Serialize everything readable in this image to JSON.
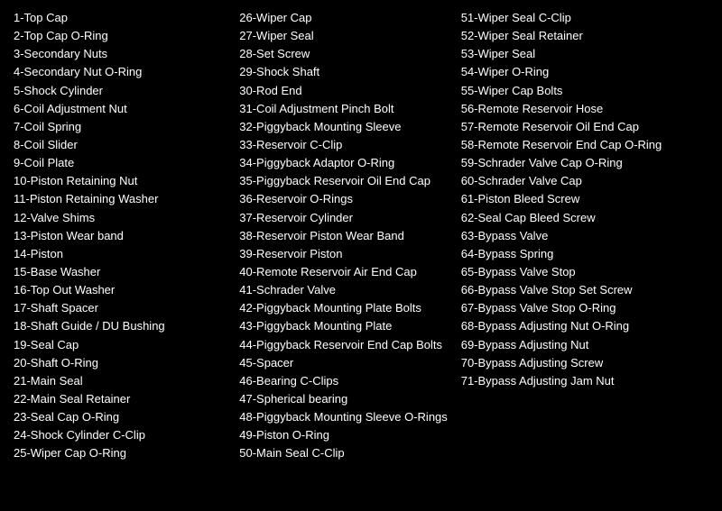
{
  "columns": [
    {
      "id": "col1",
      "items": [
        "1-Top Cap",
        "2-Top Cap O-Ring",
        "3-Secondary Nuts",
        "4-Secondary Nut O-Ring",
        "5-Shock Cylinder",
        "6-Coil Adjustment Nut",
        "7-Coil Spring",
        "8-Coil Slider",
        "9-Coil Plate",
        "10-Piston Retaining Nut",
        "11-Piston Retaining Washer",
        "12-Valve Shims",
        "13-Piston Wear band",
        "14-Piston",
        "15-Base Washer",
        "16-Top Out Washer",
        "17-Shaft Spacer",
        "18-Shaft Guide / DU Bushing",
        "19-Seal Cap",
        "20-Shaft O-Ring",
        "21-Main Seal",
        "22-Main Seal Retainer",
        "23-Seal Cap O-Ring",
        "24-Shock Cylinder C-Clip",
        "25-Wiper Cap O-Ring"
      ]
    },
    {
      "id": "col2",
      "items": [
        "26-Wiper Cap",
        "27-Wiper Seal",
        "28-Set Screw",
        "29-Shock Shaft",
        "30-Rod End",
        "31-Coil Adjustment Pinch Bolt",
        "32-Piggyback Mounting Sleeve",
        "33-Reservoir C-Clip",
        "34-Piggyback Adaptor O-Ring",
        "35-Piggyback Reservoir Oil End Cap",
        "36-Reservoir O-Rings",
        "37-Reservoir Cylinder",
        "38-Reservoir Piston Wear Band",
        "39-Reservoir Piston",
        "40-Remote Reservoir Air End Cap",
        "41-Schrader Valve",
        "42-Piggyback Mounting Plate Bolts",
        "43-Piggyback Mounting Plate",
        "44-Piggyback Reservoir End Cap Bolts",
        "45-Spacer",
        "46-Bearing C-Clips",
        "47-Spherical bearing",
        "48-Piggyback Mounting Sleeve O-Rings",
        "49-Piston O-Ring",
        "50-Main Seal C-Clip"
      ]
    },
    {
      "id": "col3",
      "items": [
        "51-Wiper Seal C-Clip",
        "52-Wiper Seal Retainer",
        "53-Wiper Seal",
        "54-Wiper O-Ring",
        "55-Wiper Cap Bolts",
        "56-Remote Reservoir Hose",
        "57-Remote Reservoir Oil End Cap",
        "58-Remote Reservoir End Cap O-Ring",
        "59-Schrader Valve Cap O-Ring",
        "60-Schrader Valve Cap",
        "61-Piston Bleed Screw",
        "62-Seal Cap Bleed Screw",
        "63-Bypass Valve",
        "64-Bypass Spring",
        "65-Bypass Valve Stop",
        "66-Bypass Valve Stop Set Screw",
        "67-Bypass Valve Stop O-Ring",
        "68-Bypass Adjusting Nut O-Ring",
        "69-Bypass Adjusting Nut",
        "70-Bypass Adjusting Screw",
        "71-Bypass Adjusting Jam Nut"
      ]
    }
  ]
}
